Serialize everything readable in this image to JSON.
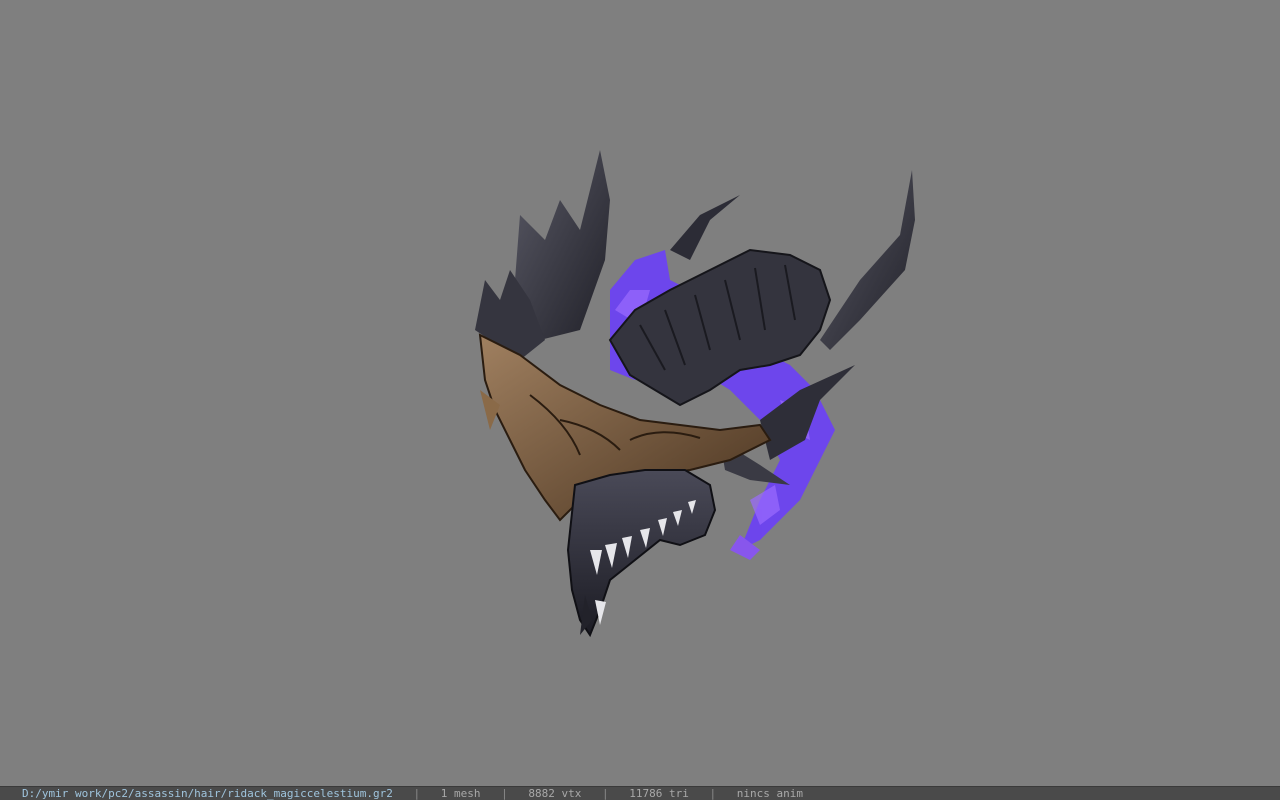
{
  "viewer": {
    "background": "#7f7f7f",
    "model_icon": "demon-helmet-model"
  },
  "status": {
    "path": "D:/ymir work/pc2/assassin/hair/ridack_magiccelestium.gr2",
    "separator": "|",
    "mesh": "1 mesh",
    "vtx": "8882 vtx",
    "tri": "11786 tri",
    "anim": "nincs anim"
  }
}
